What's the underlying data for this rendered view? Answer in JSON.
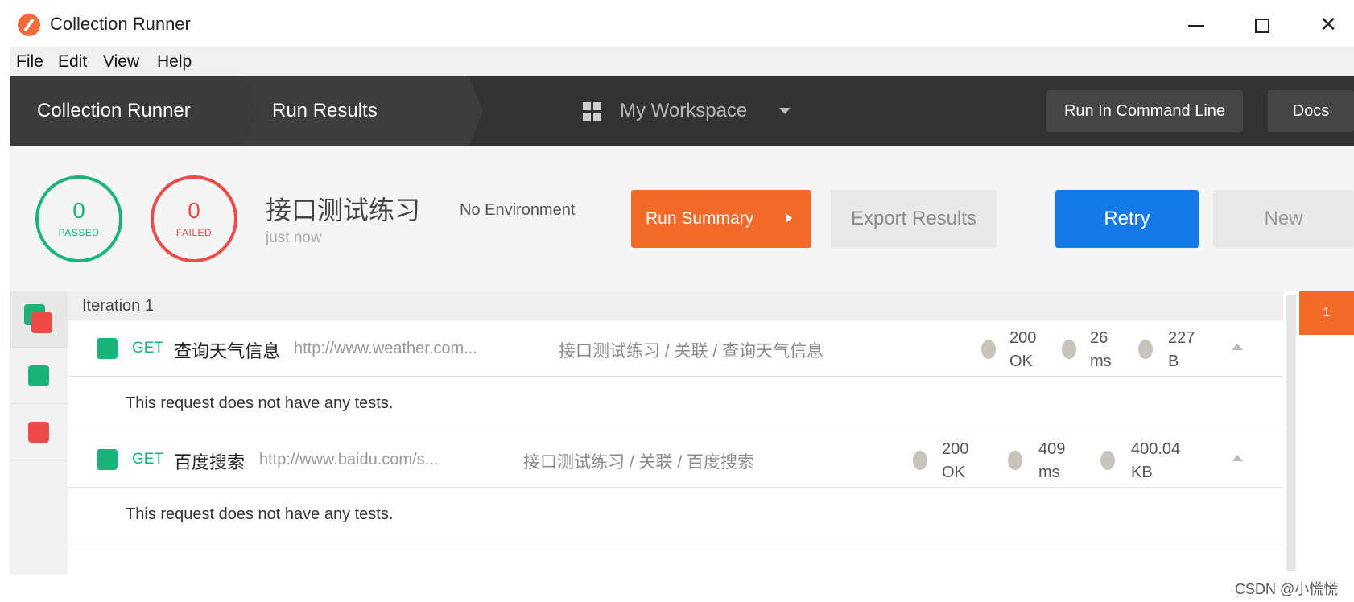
{
  "window": {
    "title": "Collection Runner"
  },
  "menu": [
    "File",
    "Edit",
    "View",
    "Help"
  ],
  "header": {
    "crumb_runner": "Collection Runner",
    "crumb_results": "Run Results",
    "workspace": "My Workspace",
    "btn_cli": "Run In Command Line",
    "btn_docs": "Docs"
  },
  "summary": {
    "passed_count": "0",
    "passed_label": "PASSED",
    "failed_count": "0",
    "failed_label": "FAILED",
    "run_name": "接口测试练习",
    "run_time": "just now",
    "environment": "No Environment",
    "btn_summary": "Run Summary",
    "btn_export": "Export Results",
    "btn_retry": "Retry",
    "btn_new": "New"
  },
  "iteration": {
    "label": "Iteration 1"
  },
  "requests": [
    {
      "method": "GET",
      "name": "查询天气信息",
      "url": "http://www.weather.com...",
      "path": "接口测试练习 / 关联 / 查询天气信息",
      "status_code": "200",
      "status_text": "OK",
      "time_value": "26",
      "time_unit": "ms",
      "size_value": "227",
      "size_unit": "B",
      "note": "This request does not have any tests."
    },
    {
      "method": "GET",
      "name": "百度搜索",
      "url": "http://www.baidu.com/s...",
      "path": "接口测试练习 / 关联 / 百度搜索",
      "status_code": "200",
      "status_text": "OK",
      "time_value": "409",
      "time_unit": "ms",
      "size_value": "400.04",
      "size_unit": "KB",
      "note": "This request does not have any tests."
    }
  ],
  "gutter": {
    "marker": "1"
  },
  "credit": "CSDN @小慌慌",
  "colors": {
    "accent_orange": "#f26b2a",
    "pass_green": "#1ab37a",
    "fail_red": "#ed4b48",
    "retry_blue": "#1479e6",
    "header_dark": "#333333"
  }
}
